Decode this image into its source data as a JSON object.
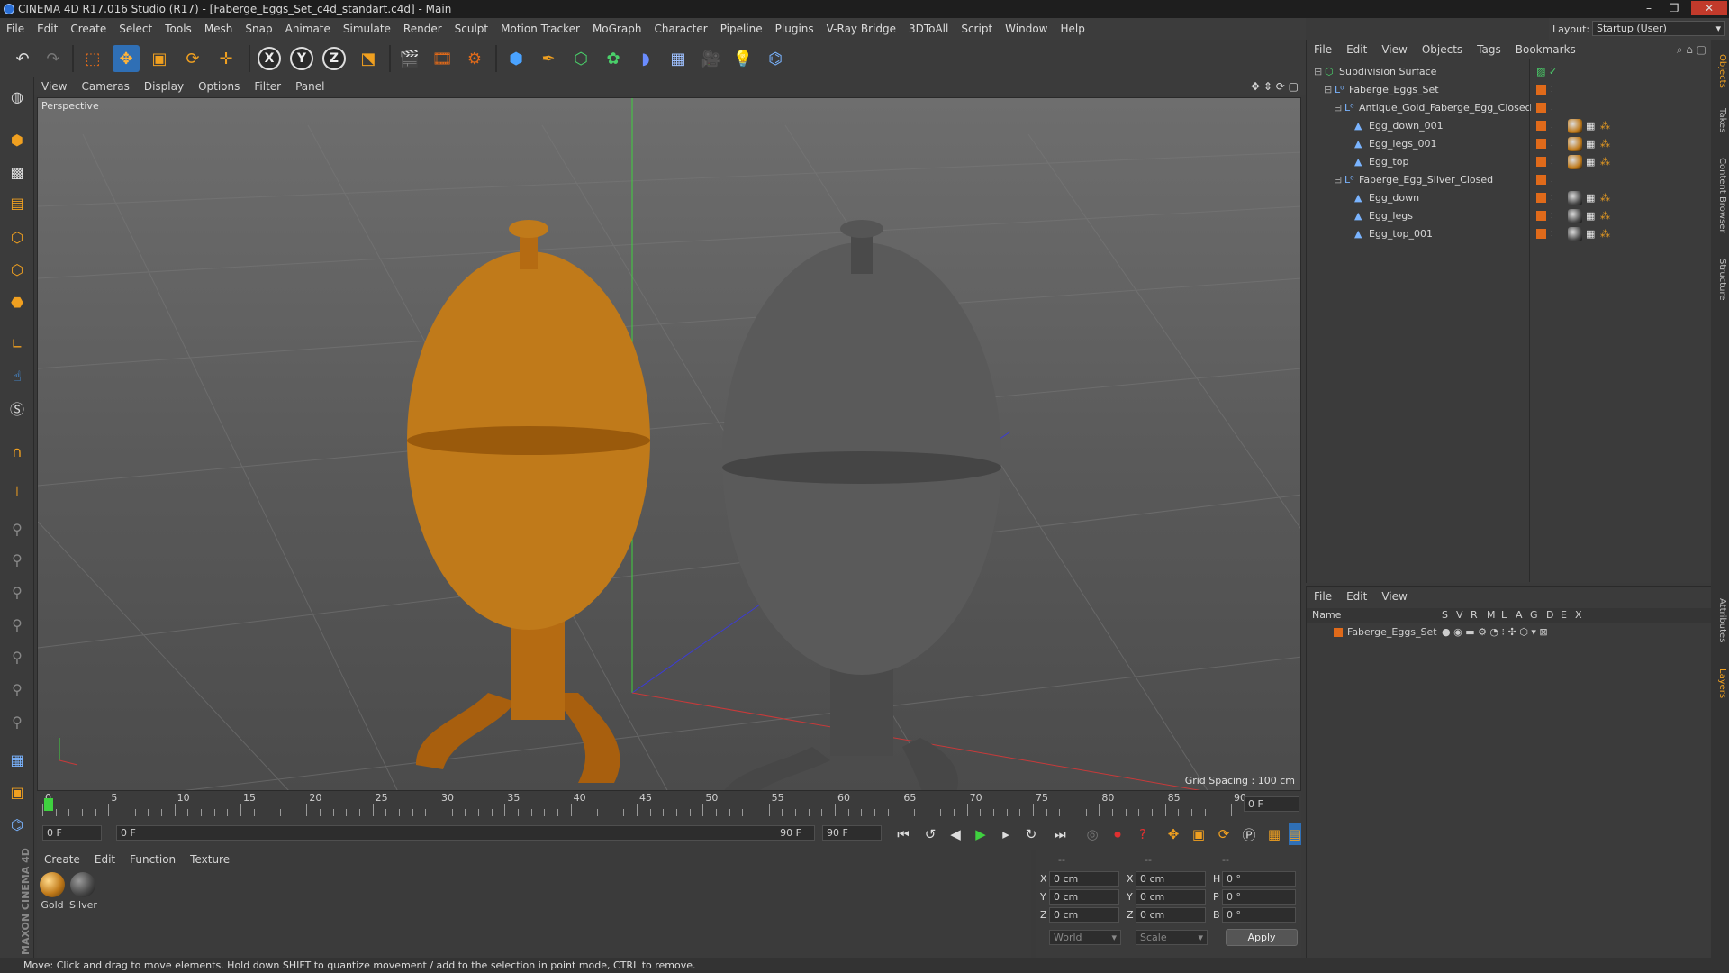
{
  "window": {
    "title": "CINEMA 4D R17.016 Studio (R17) - [Faberge_Eggs_Set_c4d_standart.c4d] - Main",
    "controls": [
      "–",
      "❐",
      "✕"
    ]
  },
  "menubar": {
    "items": [
      "File",
      "Edit",
      "Create",
      "Select",
      "Tools",
      "Mesh",
      "Snap",
      "Animate",
      "Simulate",
      "Render",
      "Sculpt",
      "Motion Tracker",
      "MoGraph",
      "Character",
      "Pipeline",
      "Plugins",
      "V-Ray Bridge",
      "3DToAll",
      "Script",
      "Window",
      "Help"
    ],
    "layout_label": "Layout:",
    "layout_value": "Startup (User)"
  },
  "toolbar": {
    "axis_x": "X",
    "axis_y": "Y",
    "axis_z": "Z"
  },
  "viewport": {
    "menu": [
      "View",
      "Cameras",
      "Display",
      "Options",
      "Filter",
      "Panel"
    ],
    "label": "Perspective",
    "grid_spacing": "Grid Spacing : 100 cm"
  },
  "timeline": {
    "ticks": [
      "0",
      "5",
      "10",
      "15",
      "20",
      "25",
      "30",
      "35",
      "40",
      "45",
      "50",
      "55",
      "60",
      "65",
      "70",
      "75",
      "80",
      "85",
      "90"
    ],
    "current_frame": "0 F",
    "start_field": "0 F",
    "range_start": "0 F",
    "range_end": "90 F",
    "end_field": "90 F"
  },
  "materials": {
    "menu": [
      "Create",
      "Edit",
      "Function",
      "Texture"
    ],
    "items": [
      {
        "name": "Gold",
        "color": "#c07a1a"
      },
      {
        "name": "Silver",
        "color": "#4a4a4a"
      }
    ]
  },
  "coordinates": {
    "header": [
      "--",
      "--",
      "--"
    ],
    "rows": [
      {
        "a": "X",
        "av": "0 cm",
        "b": "X",
        "bv": "0 cm",
        "c": "H",
        "cv": "0 °"
      },
      {
        "a": "Y",
        "av": "0 cm",
        "b": "Y",
        "bv": "0 cm",
        "c": "P",
        "cv": "0 °"
      },
      {
        "a": "Z",
        "av": "0 cm",
        "b": "Z",
        "bv": "0 cm",
        "c": "B",
        "cv": "0 °"
      }
    ],
    "mode": "World",
    "scale": "Scale",
    "apply": "Apply"
  },
  "objects": {
    "menu": [
      "File",
      "Edit",
      "View",
      "Objects",
      "Tags",
      "Bookmarks"
    ],
    "tree": [
      {
        "name": "Subdivision Surface",
        "indent": 0,
        "icon": "subdivision-icon"
      },
      {
        "name": "Faberge_Eggs_Set",
        "indent": 1,
        "icon": "null-icon"
      },
      {
        "name": "Antique_Gold_Faberge_Egg_Closed",
        "indent": 2,
        "icon": "null-icon"
      },
      {
        "name": "Egg_down_001",
        "indent": 3,
        "icon": "polygon-icon",
        "mat": "gold"
      },
      {
        "name": "Egg_legs_001",
        "indent": 3,
        "icon": "polygon-icon",
        "mat": "gold"
      },
      {
        "name": "Egg_top",
        "indent": 3,
        "icon": "polygon-icon",
        "mat": "gold"
      },
      {
        "name": "Faberge_Egg_Silver_Closed",
        "indent": 2,
        "icon": "null-icon"
      },
      {
        "name": "Egg_down",
        "indent": 3,
        "icon": "polygon-icon",
        "mat": "silver"
      },
      {
        "name": "Egg_legs",
        "indent": 3,
        "icon": "polygon-icon",
        "mat": "silver"
      },
      {
        "name": "Egg_top_001",
        "indent": 3,
        "icon": "polygon-icon",
        "mat": "silver"
      }
    ]
  },
  "layers": {
    "menu": [
      "File",
      "Edit",
      "View"
    ],
    "columns": [
      "Name",
      "S",
      "V",
      "R",
      "M",
      "L",
      "A",
      "G",
      "D",
      "E",
      "X"
    ],
    "rows": [
      {
        "name": "Faberge_Eggs_Set",
        "color": "#e06a1a"
      }
    ]
  },
  "side_tabs": [
    "Objects",
    "Takes",
    "Content Browser",
    "Structure",
    "Attributes",
    "Layers"
  ],
  "status": "Move: Click and drag to move elements. Hold down SHIFT to quantize movement / add to the selection in point mode, CTRL to remove.",
  "branding": "MAXON CINEMA 4D",
  "colors": {
    "accent_orange": "#e06a1a",
    "gold": "#c07a1a",
    "silver": "#4a4a4a",
    "selection_blue": "#2f6fb5"
  }
}
